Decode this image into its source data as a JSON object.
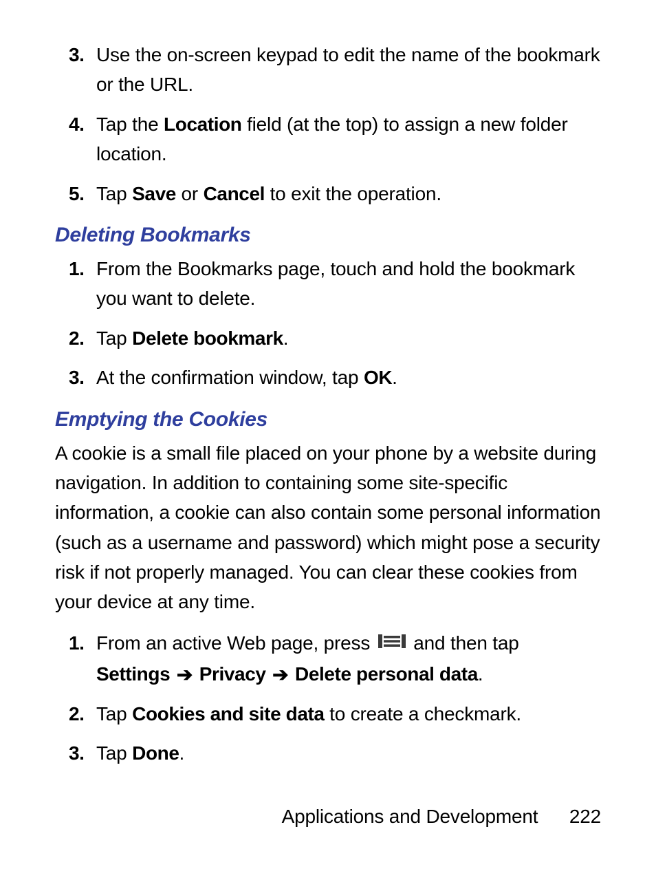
{
  "sectionA": {
    "items": [
      {
        "num": "3.",
        "text_plain": "Use the on-screen keypad to edit the name of the bookmark or the URL."
      },
      {
        "num": "4.",
        "text_before": "Tap the ",
        "bold1": "Location",
        "text_after": " field (at the top) to assign a new folder location."
      },
      {
        "num": "5.",
        "text_before": "Tap ",
        "bold1": "Save",
        "text_mid": " or ",
        "bold2": "Cancel",
        "text_after": " to exit the operation."
      }
    ]
  },
  "sectionB": {
    "heading": "Deleting Bookmarks",
    "items": [
      {
        "num": "1.",
        "text_plain": "From the Bookmarks page, touch and hold the bookmark you want to delete."
      },
      {
        "num": "2.",
        "text_before": "Tap ",
        "bold1": "Delete bookmark",
        "text_after": "."
      },
      {
        "num": "3.",
        "text_before": "At the confirmation window, tap ",
        "bold1": "OK",
        "text_after": "."
      }
    ]
  },
  "sectionC": {
    "heading": "Emptying the Cookies",
    "paragraph": "A cookie is a small file placed on your phone by a website during navigation. In addition to containing some site-specific information, a cookie can also contain some personal information (such as a username and password) which might pose a security risk if not properly managed. You can clear these cookies from your device at any time.",
    "items": [
      {
        "num": "1.",
        "line1_before": "From an active Web page, press ",
        "line1_after": " and then tap",
        "path_b1": "Settings",
        "path_b2": "Privacy",
        "path_b3": "Delete personal data",
        "dot": "."
      },
      {
        "num": "2.",
        "text_before": "Tap ",
        "bold1": "Cookies and site data",
        "text_after": " to create a checkmark."
      },
      {
        "num": "3.",
        "text_before": "Tap ",
        "bold1": "Done",
        "text_after": "."
      }
    ]
  },
  "footer": {
    "section": "Applications and Development",
    "page": "222"
  },
  "glyphs": {
    "arrow": "➔"
  }
}
